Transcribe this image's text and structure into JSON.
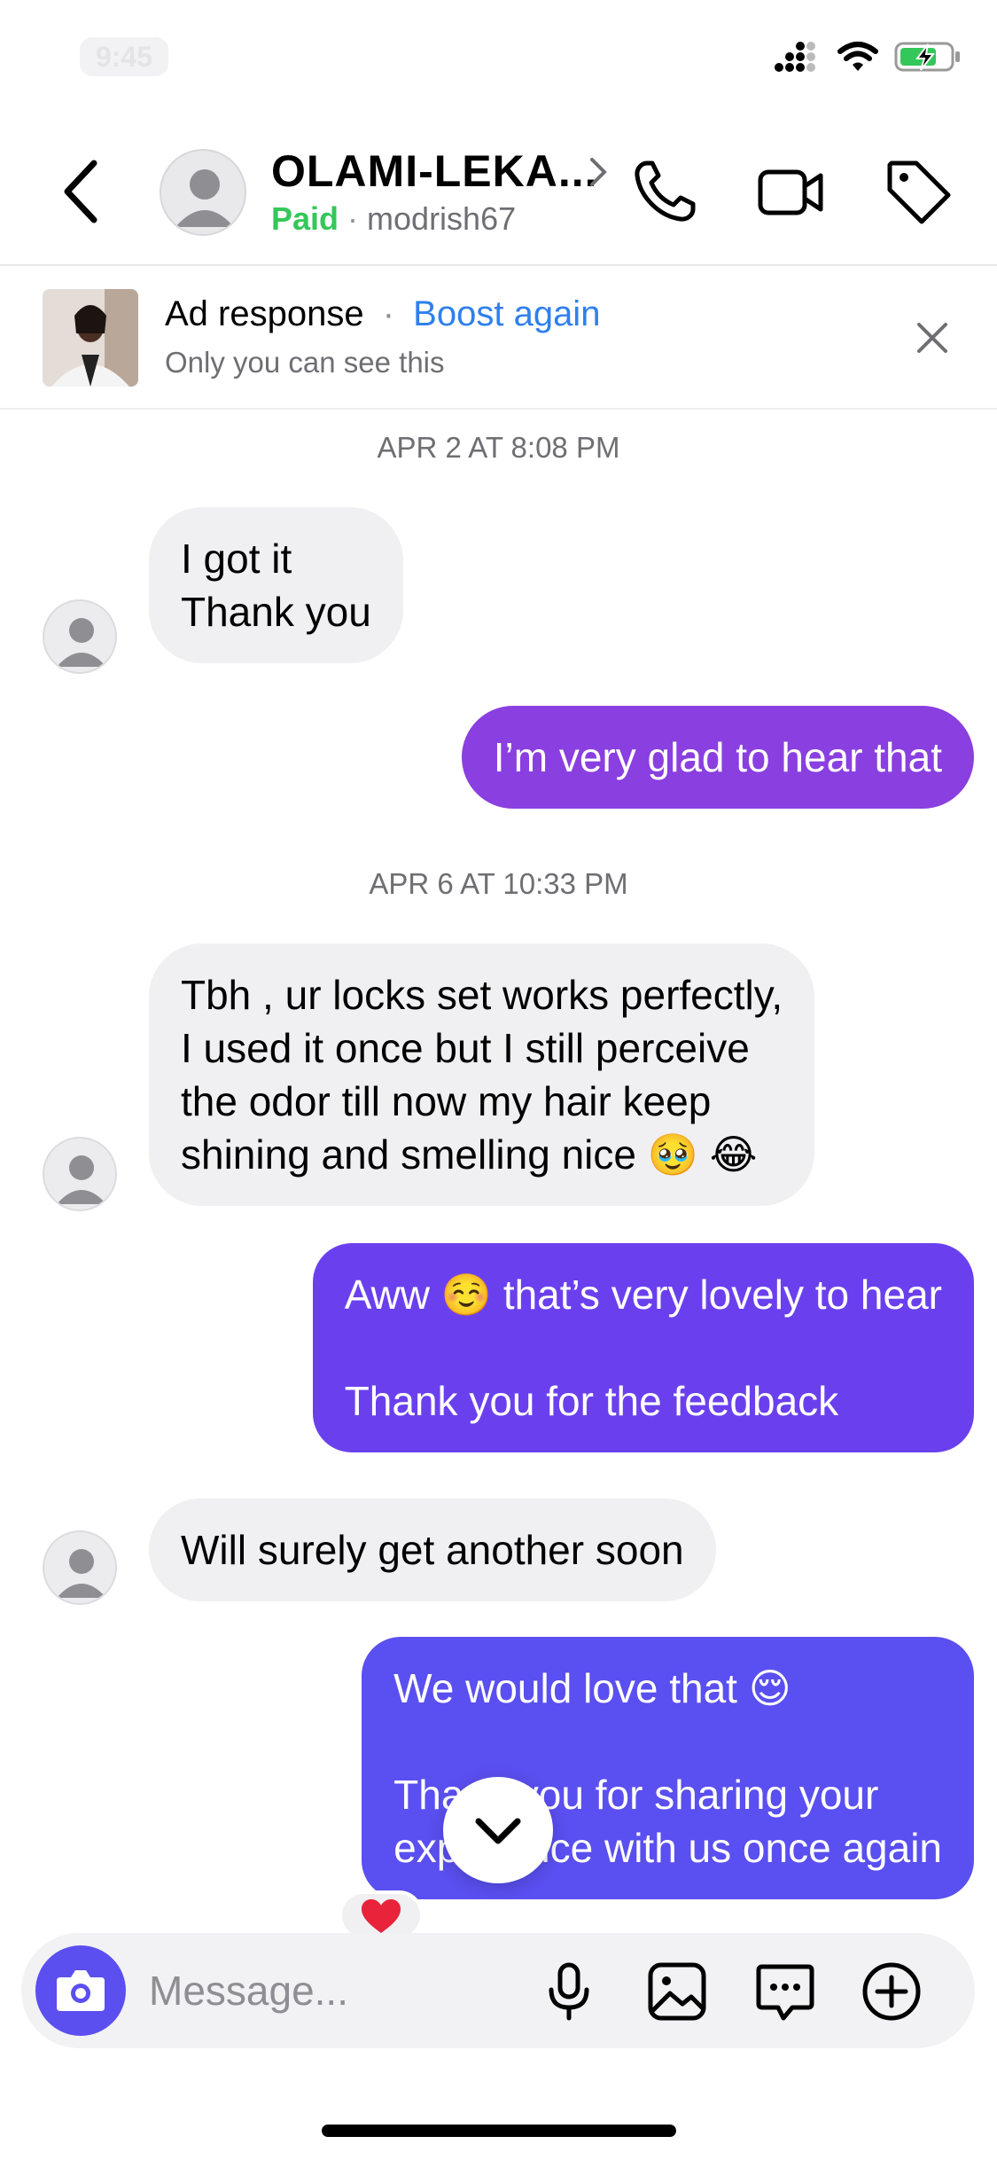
{
  "status_bar": {
    "time": "9:45"
  },
  "header": {
    "contact_name": "OLAMI-LEKA...",
    "paid_label": "Paid",
    "separator": "·",
    "handle": "modrish67"
  },
  "ad_banner": {
    "title": "Ad response",
    "separator": "·",
    "boost_label": "Boost again",
    "subtitle": "Only you can see this"
  },
  "messages": {
    "ts1": "APR 2 AT 8:08 PM",
    "m1": "I got it\nThank you",
    "m2": "I’m very glad to hear that",
    "ts2": "APR 6 AT 10:33 PM",
    "m3": "Tbh , ur locks set works perfectly,\nI used it once but I still perceive\nthe odor till now  my hair keep\nshining and smelling nice 🥹 😂",
    "m4": "Aww ☺️ that’s very lovely to hear\n\nThank you for the feedback",
    "m5": "Will surely get another soon",
    "m6": "We would love that 😌\n\nThank you for sharing your\nexperience with us once again",
    "reaction": "❤️"
  },
  "composer": {
    "placeholder": "Message..."
  },
  "colors": {
    "paid_green": "#34c759",
    "boost_blue": "#2f80ed",
    "outgoing_purple_1": "#8a3fe0",
    "outgoing_purple_2": "#6a40ee",
    "outgoing_purple_3": "#5a4ff0",
    "camera_button": "#5b4ff0",
    "incoming_gray": "#f0f0f2"
  },
  "icons": {
    "header": [
      "back-chevron-icon",
      "phone-icon",
      "video-camera-icon",
      "tag-icon"
    ],
    "composer": [
      "camera-icon",
      "microphone-icon",
      "image-icon",
      "chat-bubble-icon",
      "plus-circle-icon"
    ]
  }
}
